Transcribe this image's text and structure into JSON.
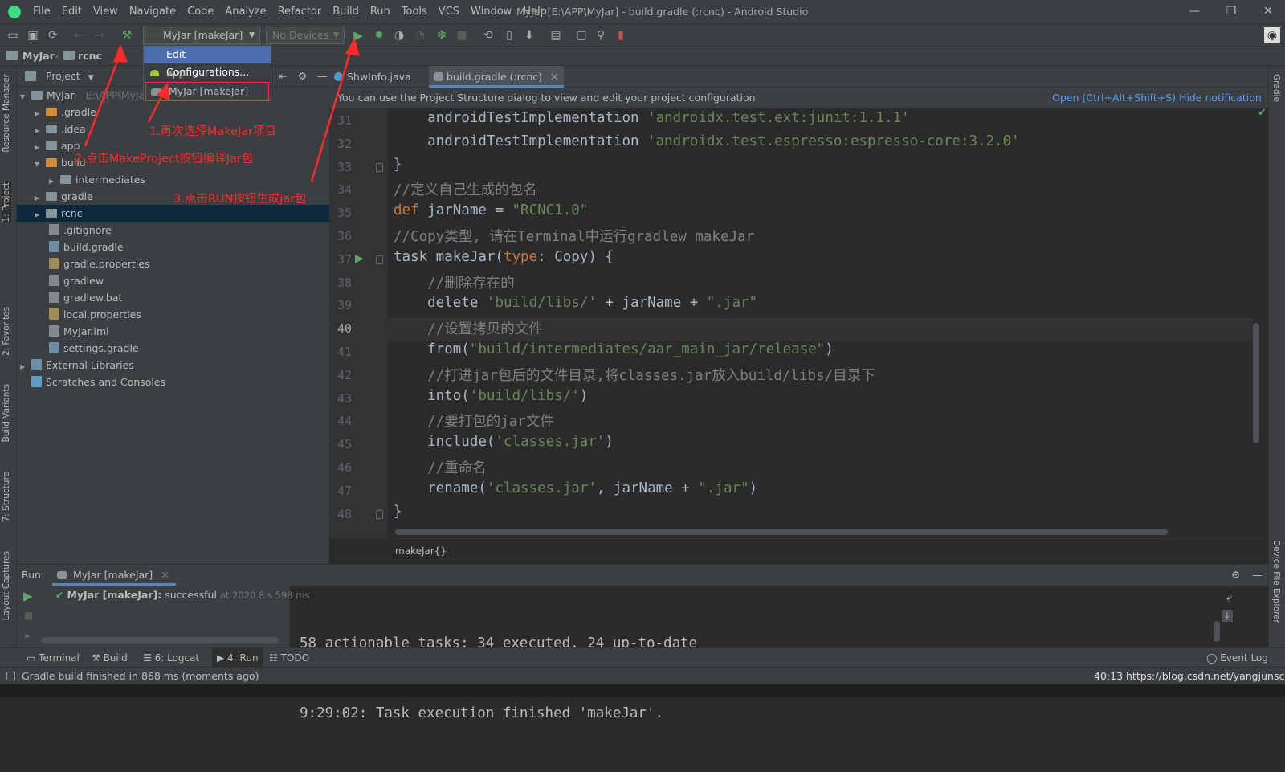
{
  "window": {
    "title": "MyJar [E:\\APP\\MyJar] - build.gradle (:rcnc) - Android Studio",
    "menu": [
      "File",
      "Edit",
      "View",
      "Navigate",
      "Code",
      "Analyze",
      "Refactor",
      "Build",
      "Run",
      "Tools",
      "VCS",
      "Window",
      "Help"
    ]
  },
  "toolbar": {
    "run_config": "MyJar [makeJar]",
    "device": "No Devices"
  },
  "dropdown": {
    "items": [
      "Edit Configurations...",
      "app",
      "MyJar [makeJar]"
    ]
  },
  "navbar": {
    "crumbs": [
      "MyJar",
      "rcnc"
    ]
  },
  "left_strip": [
    "Resource Manager",
    "1: Project",
    "2: Favorites",
    "Build Variants",
    "7: Structure",
    "Layout Captures"
  ],
  "right_strip": [
    "Gradle",
    "Device File Explorer"
  ],
  "project": {
    "header": "Project",
    "root": "MyJar",
    "root_path": "E:\\APP\\MyJa",
    "items": [
      ".gradle",
      ".idea",
      "app",
      "build",
      "intermediates",
      "gradle",
      "rcnc",
      ".gitignore",
      "build.gradle",
      "gradle.properties",
      "gradlew",
      "gradlew.bat",
      "local.properties",
      "MyJar.iml",
      "settings.gradle",
      "External Libraries",
      "Scratches and Consoles"
    ]
  },
  "editor": {
    "tabs": [
      "ShwInfo.java",
      "build.gradle (:rcnc)"
    ],
    "notification": "You can use the Project Structure dialog to view and edit your project configuration",
    "notif_open": "Open (Ctrl+Alt+Shift+S)",
    "notif_hide": "Hide notification",
    "line_numbers": [
      "31",
      "32",
      "33",
      "34",
      "35",
      "36",
      "37",
      "38",
      "39",
      "40",
      "41",
      "42",
      "43",
      "44",
      "45",
      "46",
      "47",
      "48"
    ],
    "code": [
      {
        "parts": [
          [
            "f",
            "    androidTestImplementation "
          ],
          [
            "s",
            "'androidx.test.ext:junit:1.1.1'"
          ]
        ]
      },
      {
        "parts": [
          [
            "f",
            "    androidTestImplementation "
          ],
          [
            "s",
            "'androidx.test.espresso:espresso-core:3.2.0'"
          ]
        ]
      },
      {
        "parts": [
          [
            "f",
            "}"
          ]
        ]
      },
      {
        "parts": [
          [
            "c",
            "//定义自己生成的包名"
          ]
        ]
      },
      {
        "parts": [
          [
            "k",
            "def "
          ],
          [
            "f",
            "jarName = "
          ],
          [
            "s",
            "\"RCNC1.0\""
          ]
        ]
      },
      {
        "parts": [
          [
            "c",
            "//Copy类型, 请在Terminal中运行gradlew makeJar"
          ]
        ]
      },
      {
        "parts": [
          [
            "f",
            "task makeJar("
          ],
          [
            "k",
            "type"
          ],
          [
            "f",
            ": Copy) {"
          ]
        ]
      },
      {
        "parts": [
          [
            "c",
            "    //删除存在的"
          ]
        ]
      },
      {
        "parts": [
          [
            "f",
            "    delete "
          ],
          [
            "s",
            "'build/libs/'"
          ],
          [
            "f",
            " + jarName + "
          ],
          [
            "s",
            "\".jar\""
          ]
        ]
      },
      {
        "parts": [
          [
            "c",
            "    //设置拷贝的文件"
          ]
        ]
      },
      {
        "parts": [
          [
            "f",
            "    from("
          ],
          [
            "s",
            "\"build/intermediates/aar_main_jar/release\""
          ],
          [
            "f",
            ")"
          ]
        ]
      },
      {
        "parts": [
          [
            "c",
            "    //打进jar包后的文件目录,将classes.jar放入build/libs/目录下"
          ]
        ]
      },
      {
        "parts": [
          [
            "f",
            "    into("
          ],
          [
            "s",
            "'build/libs/'"
          ],
          [
            "f",
            ")"
          ]
        ]
      },
      {
        "parts": [
          [
            "c",
            "    //要打包的jar文件"
          ]
        ]
      },
      {
        "parts": [
          [
            "f",
            "    include("
          ],
          [
            "s",
            "'classes.jar'"
          ],
          [
            "f",
            ")"
          ]
        ]
      },
      {
        "parts": [
          [
            "c",
            "    //重命名"
          ]
        ]
      },
      {
        "parts": [
          [
            "f",
            "    rename("
          ],
          [
            "s",
            "'classes.jar'"
          ],
          [
            "f",
            ", jarName + "
          ],
          [
            "s",
            "\".jar\""
          ],
          [
            "f",
            ")"
          ]
        ]
      },
      {
        "parts": [
          [
            "f",
            "}"
          ]
        ]
      }
    ],
    "breadcrumb": "makeJar{}"
  },
  "run": {
    "label": "Run:",
    "tab": "MyJar [makeJar]",
    "task_name": "MyJar [makeJar]:",
    "task_status": "successful",
    "task_time": "at 2020 8 s 598 ms",
    "console": [
      "58 actionable tasks: 34 executed, 24 up-to-date",
      "9:29:02: Task execution finished 'makeJar'."
    ]
  },
  "bottom_tabs": [
    "Terminal",
    "Build",
    "6: Logcat",
    "4: Run",
    "TODO"
  ],
  "event_log": "Event Log",
  "status": "Gradle build finished in 868 ms (moments ago)",
  "status_right": "40:13  https://blog.csdn.net/yangjunsc",
  "annotations": [
    "1.再次选择MakeJar项目",
    "2.点击MakeProject按钮编译Jar包",
    "3.点击RUN按钮生成jar包"
  ],
  "colors": {
    "annotation": "#ff2a2a",
    "link": "#589df6",
    "selection": "#0d293e",
    "dropdown_selected": "#4b6eaf"
  }
}
